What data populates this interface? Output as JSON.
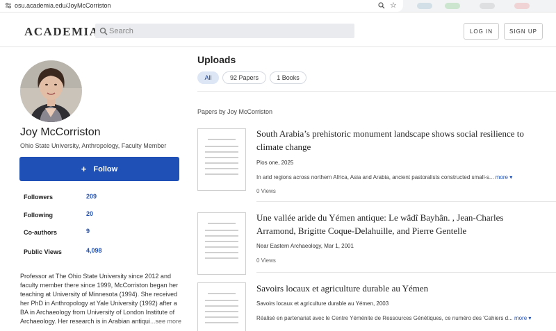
{
  "browser": {
    "url": "osu.academia.edu/JoyMcCorriston",
    "icons": [
      "site-info-icon",
      "zoom-icon",
      "bookmark-star-icon"
    ]
  },
  "header": {
    "logo": "ACADEMIA",
    "search_placeholder": "Search",
    "login_label": "LOG IN",
    "signup_label": "SIGN UP"
  },
  "profile": {
    "name": "Joy McCorriston",
    "affiliation": "Ohio State University, Anthropology, Faculty Member",
    "follow_label": "Follow",
    "stats": [
      {
        "label": "Followers",
        "value": "209"
      },
      {
        "label": "Following",
        "value": "20"
      },
      {
        "label": "Co-authors",
        "value": "9"
      },
      {
        "label": "Public Views",
        "value": "4,098"
      }
    ],
    "bio_lines": [
      "Professor at The Ohio State University since 2012 and",
      "faculty member there since 1999, McCorriston began her",
      "teaching at University of Minnesota (1994). She received",
      "her PhD in Anthropology at Yale University (1992) after a",
      "BA in Archaeology from University of London Institute of",
      "Archaeology. Her research is in Arabian antiqui"
    ],
    "bio_more": "...see more"
  },
  "uploads": {
    "title": "Uploads",
    "tabs": [
      {
        "label": "All",
        "active": true
      },
      {
        "label": "92 Papers",
        "active": false
      },
      {
        "label": "1 Books",
        "active": false
      }
    ],
    "section_label": "Papers by Joy McCorriston",
    "papers": [
      {
        "title_lines": [
          "South Arabia’s prehistoric monument landscape shows social resilience to",
          "climate change"
        ],
        "meta": "Plos one, 2025",
        "snippet": "In arid regions across northern Africa, Asia and Arabia, ancient pastoralists constructed small-s...",
        "more": "more",
        "views": "0 Views"
      },
      {
        "title_lines": [
          "Une vallée aride du Yémen antique: Le wâdî Bayhân. , Jean-Charles",
          "Arramond, Brigitte Coque-Delahuille, and Pierre Gentelle"
        ],
        "meta": "Near Eastern Archaeology, Mar 1, 2001",
        "snippet": "",
        "more": "",
        "views": "0 Views"
      },
      {
        "title_lines": [
          "Savoirs locaux et agriculture durable au Yémen"
        ],
        "meta": "Savoirs locaux et agriculture durable au Yémen, 2003",
        "snippet": "Réalisé en partenariat avec le Centre Yéménite de Ressources Génétiques, ce numéro des 'Cahiers d...",
        "more": "more",
        "views": ""
      }
    ]
  },
  "colors": {
    "brand_blue": "#1f50b5",
    "active_chip": "#dde6f5",
    "search_bg": "#e9ebee"
  }
}
